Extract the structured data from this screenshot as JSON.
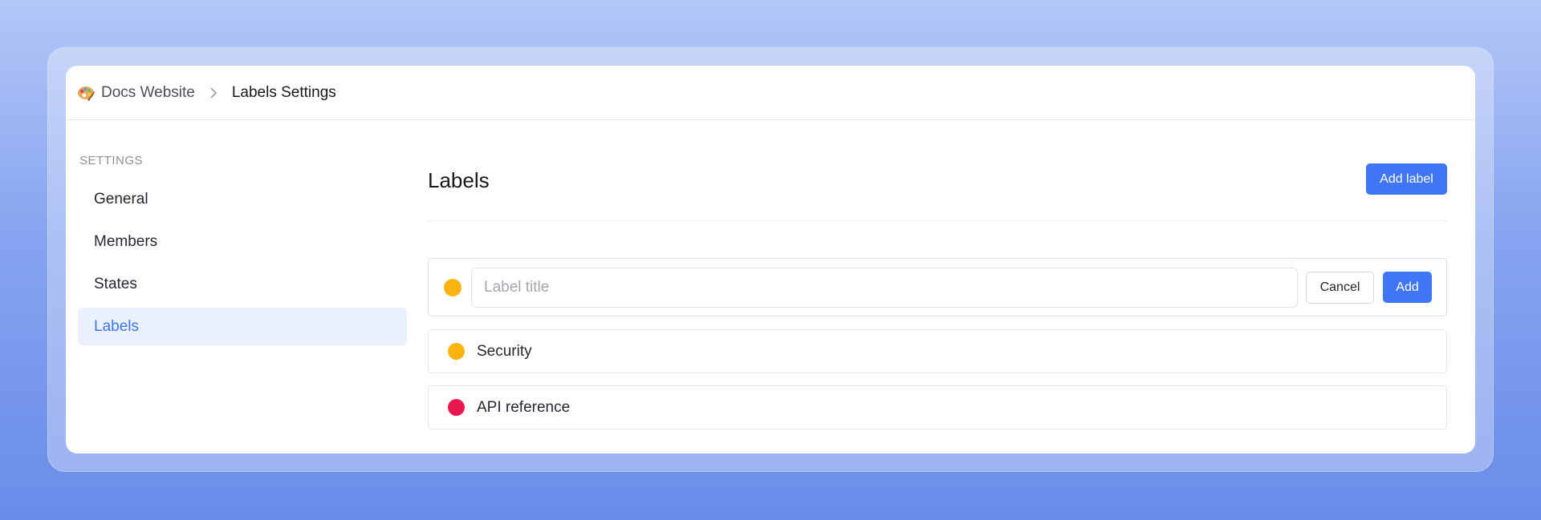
{
  "breadcrumb": {
    "project": "Docs Website",
    "page": "Labels Settings"
  },
  "sidebar": {
    "heading": "SETTINGS",
    "items": [
      {
        "label": "General"
      },
      {
        "label": "Members"
      },
      {
        "label": "States"
      },
      {
        "label": "Labels"
      }
    ],
    "active_item": "Labels"
  },
  "main": {
    "title": "Labels",
    "add_label_button": "Add label",
    "new_label": {
      "color": "#fbb40f",
      "placeholder": "Label title",
      "value": "",
      "cancel_button": "Cancel",
      "add_button": "Add"
    },
    "labels": [
      {
        "name": "Security",
        "color": "#fbb40f"
      },
      {
        "name": "API reference",
        "color": "#e9164f"
      }
    ]
  },
  "colors": {
    "accent": "#3f76f6",
    "active_bg": "#eaf0fd",
    "active_text": "#3f76e9"
  }
}
